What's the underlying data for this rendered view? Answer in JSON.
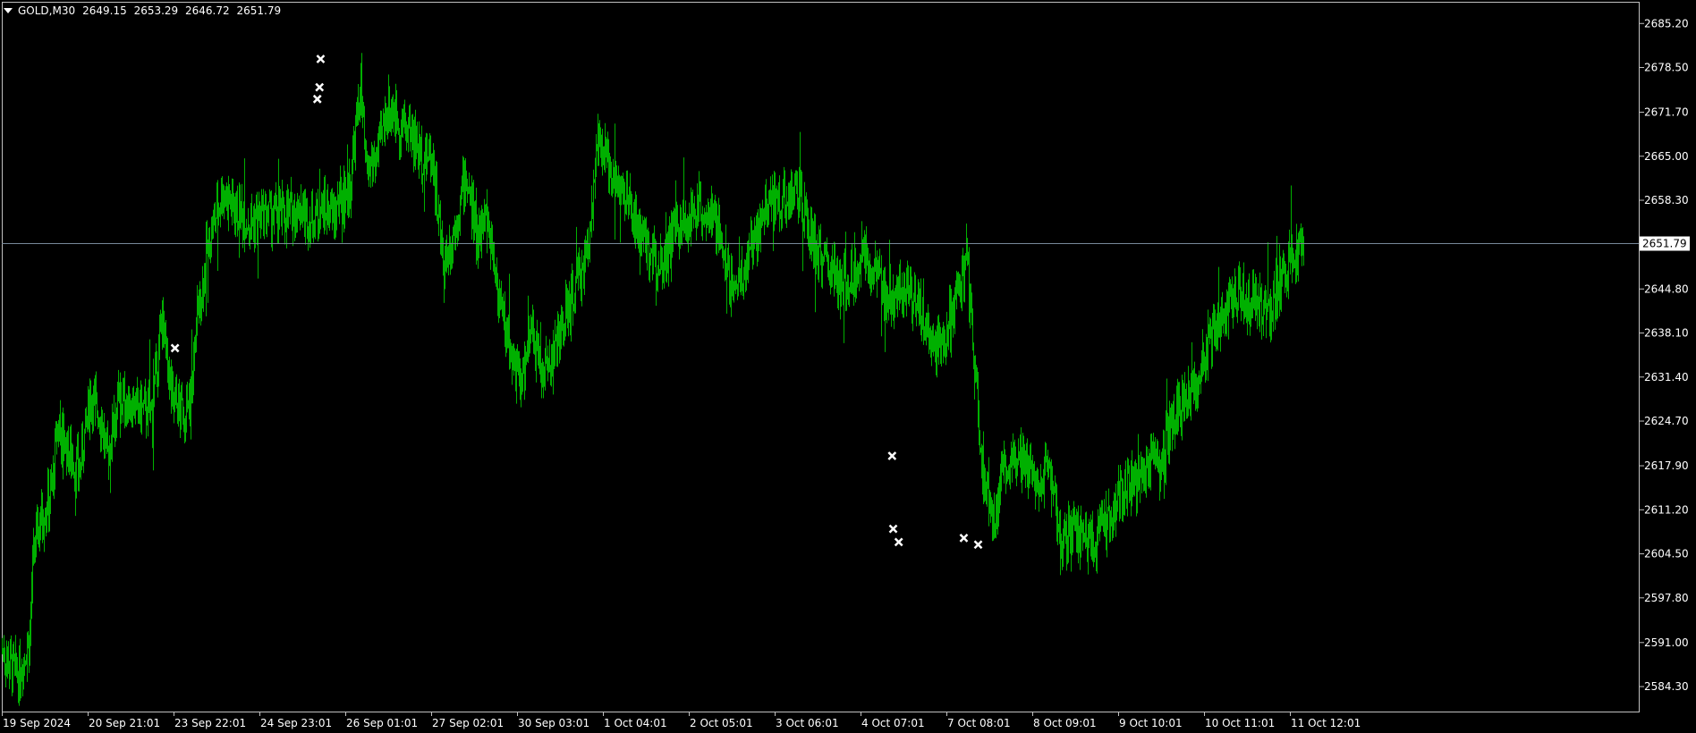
{
  "header": {
    "symbol": "GOLD,M30",
    "open": "2649.15",
    "high": "2653.29",
    "low": "2646.72",
    "close": "2651.79"
  },
  "colors": {
    "background": "#000000",
    "frame": "#c0c0c0",
    "candle": "#00b000",
    "current_price_line": "#778899",
    "markers": "#ffffff",
    "text": "#ffffff"
  },
  "chart_data": {
    "type": "bar",
    "title": "GOLD,M30",
    "symbol": "GOLD",
    "timeframe": "M30",
    "current_price": 2651.79,
    "current_price_label": "2651.79",
    "ylim": [
      2580.5,
      2688.5
    ],
    "yticks": [
      "2685.20",
      "2678.50",
      "2671.70",
      "2665.00",
      "2658.30",
      "2644.80",
      "2638.10",
      "2631.40",
      "2624.70",
      "2617.90",
      "2611.20",
      "2604.50",
      "2597.80",
      "2591.00",
      "2584.30"
    ],
    "xticks": [
      "19 Sep 2024",
      "20 Sep 21:01",
      "23 Sep 22:01",
      "24 Sep 23:01",
      "26 Sep 01:01",
      "27 Sep 02:01",
      "30 Sep 03:01",
      "1 Oct 04:01",
      "2 Oct 05:01",
      "3 Oct 06:01",
      "4 Oct 07:01",
      "7 Oct 08:01",
      "8 Oct 09:01",
      "9 Oct 10:01",
      "10 Oct 11:01",
      "11 Oct 12:01"
    ],
    "price_path": [
      [
        0,
        2590
      ],
      [
        0.01,
        2587
      ],
      [
        0.015,
        2586
      ],
      [
        0.025,
        2592
      ],
      [
        0.028,
        2604
      ],
      [
        0.035,
        2610
      ],
      [
        0.045,
        2614
      ],
      [
        0.05,
        2624
      ],
      [
        0.06,
        2620
      ],
      [
        0.07,
        2617
      ],
      [
        0.08,
        2629
      ],
      [
        0.09,
        2625
      ],
      [
        0.095,
        2619
      ],
      [
        0.105,
        2628
      ],
      [
        0.12,
        2627
      ],
      [
        0.135,
        2626
      ],
      [
        0.145,
        2640
      ],
      [
        0.155,
        2627
      ],
      [
        0.17,
        2626
      ],
      [
        0.175,
        2637
      ],
      [
        0.185,
        2650
      ],
      [
        0.2,
        2660
      ],
      [
        0.21,
        2657
      ],
      [
        0.225,
        2655
      ],
      [
        0.24,
        2656
      ],
      [
        0.255,
        2656
      ],
      [
        0.27,
        2657
      ],
      [
        0.28,
        2655
      ],
      [
        0.29,
        2657
      ],
      [
        0.3,
        2656
      ],
      [
        0.305,
        2658
      ],
      [
        0.315,
        2660
      ],
      [
        0.325,
        2676
      ],
      [
        0.33,
        2662
      ],
      [
        0.34,
        2665
      ],
      [
        0.35,
        2673
      ],
      [
        0.36,
        2670
      ],
      [
        0.37,
        2669
      ],
      [
        0.38,
        2665
      ],
      [
        0.39,
        2665
      ],
      [
        0.4,
        2648
      ],
      [
        0.41,
        2654
      ],
      [
        0.42,
        2662
      ],
      [
        0.43,
        2653
      ],
      [
        0.44,
        2656
      ],
      [
        0.45,
        2644
      ],
      [
        0.46,
        2636
      ],
      [
        0.47,
        2630
      ],
      [
        0.48,
        2638
      ],
      [
        0.49,
        2632
      ],
      [
        0.5,
        2635
      ],
      [
        0.52,
        2645
      ],
      [
        0.53,
        2650
      ],
      [
        0.54,
        2666
      ],
      [
        0.55,
        2664
      ],
      [
        0.56,
        2660
      ],
      [
        0.57,
        2657
      ],
      [
        0.58,
        2652
      ],
      [
        0.59,
        2650
      ],
      [
        0.6,
        2649
      ],
      [
        0.61,
        2654
      ],
      [
        0.62,
        2654
      ],
      [
        0.63,
        2658
      ],
      [
        0.64,
        2656
      ],
      [
        0.65,
        2653
      ],
      [
        0.66,
        2646
      ],
      [
        0.67,
        2646
      ],
      [
        0.68,
        2652
      ],
      [
        0.69,
        2656
      ],
      [
        0.7,
        2658
      ],
      [
        0.71,
        2658
      ],
      [
        0.72,
        2660
      ],
      [
        0.73,
        2654
      ],
      [
        0.74,
        2650
      ],
      [
        0.75,
        2648
      ],
      [
        0.76,
        2645
      ],
      [
        0.77,
        2647
      ],
      [
        0.78,
        2650
      ],
      [
        0.79,
        2648
      ],
      [
        0.8,
        2644
      ],
      [
        0.81,
        2645
      ],
      [
        0.82,
        2646
      ],
      [
        0.83,
        2643
      ],
      [
        0.84,
        2638
      ],
      [
        0.85,
        2636
      ],
      [
        0.86,
        2640
      ],
      [
        0.87,
        2646
      ],
      [
        0.875,
        2650
      ],
      [
        0.88,
        2636
      ],
      [
        0.89,
        2616
      ],
      [
        0.9,
        2610
      ],
      [
        0.91,
        2618
      ],
      [
        0.92,
        2620
      ],
      [
        0.93,
        2618
      ],
      [
        0.94,
        2616
      ],
      [
        0.95,
        2617
      ],
      [
        0.96,
        2606
      ],
      [
        0.97,
        2608
      ],
      [
        0.98,
        2607
      ],
      [
        0.99,
        2606
      ],
      [
        1.0,
        2609
      ],
      [
        1.01,
        2612
      ],
      [
        1.02,
        2615
      ],
      [
        1.03,
        2616
      ],
      [
        1.04,
        2617
      ],
      [
        1.05,
        2618
      ],
      [
        1.06,
        2624
      ],
      [
        1.07,
        2628
      ],
      [
        1.08,
        2630
      ],
      [
        1.09,
        2634
      ],
      [
        1.1,
        2640
      ],
      [
        1.12,
        2644
      ],
      [
        1.13,
        2643
      ],
      [
        1.15,
        2642
      ],
      [
        1.16,
        2646
      ],
      [
        1.17,
        2650
      ],
      [
        1.18,
        2651.79
      ]
    ],
    "markers": [
      {
        "x": 0.157,
        "price": 2635.8
      },
      {
        "x": 0.289,
        "price": 2679.8
      },
      {
        "x": 0.288,
        "price": 2675.5
      },
      {
        "x": 0.286,
        "price": 2673.7
      },
      {
        "x": 0.807,
        "price": 2619.4
      },
      {
        "x": 0.808,
        "price": 2608.3
      },
      {
        "x": 0.813,
        "price": 2606.3
      },
      {
        "x": 0.872,
        "price": 2606.9
      },
      {
        "x": 0.885,
        "price": 2605.9
      }
    ]
  }
}
